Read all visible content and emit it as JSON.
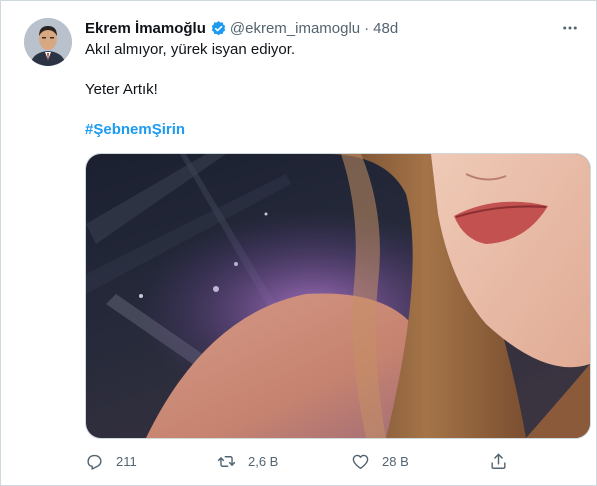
{
  "tweet": {
    "author_name": "Ekrem İmamoğlu",
    "handle": "@ekrem_imamoglu",
    "separator": "·",
    "time": "48d",
    "line1": "Akıl almıyor, yürek isyan ediyor.",
    "line2": "Yeter Artık!",
    "hashtag": "#ŞebnemŞirin"
  },
  "icons": {
    "avatar": "author-avatar",
    "verified": "verified-badge-icon",
    "more": "more-icon",
    "reply": "reply-icon",
    "retweet": "retweet-icon",
    "like": "heart-icon",
    "share": "share-icon"
  },
  "stats": {
    "replies": "211",
    "retweets": "2,6 B",
    "likes": "28 B"
  },
  "colors": {
    "link": "#1d9bf0",
    "secondary_text": "#536471",
    "primary_text": "#0f1419"
  }
}
